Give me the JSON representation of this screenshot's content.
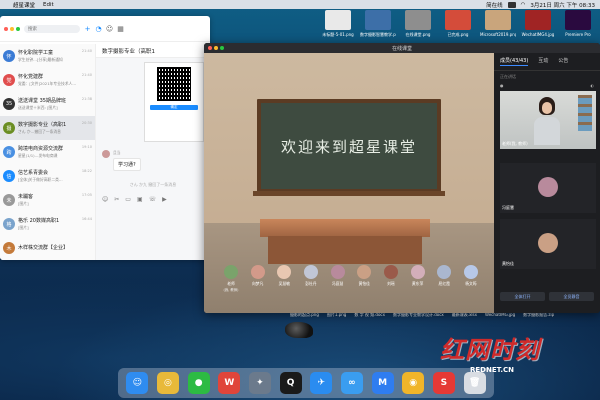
{
  "menubar": {
    "app_name": "超星课堂",
    "edit": "Edit",
    "clock": "3月21日 周六 下午 08:33",
    "tray_label": "简在线"
  },
  "desktop": {
    "files_top": [
      {
        "name": "未标题-5-01.png",
        "color": "#e9e9e9"
      },
      {
        "name": "数字摄影智慧教学.png",
        "color": "#3d6fa8"
      },
      {
        "name": "在线课堂.png",
        "color": "#8e8e8e"
      },
      {
        "name": "已完成.png",
        "color": "#d44c3a"
      },
      {
        "name": "Microsoft2019.png",
        "color": "#c9a57c"
      },
      {
        "name": "WechatIMG4.jpg",
        "color": "#a02424"
      },
      {
        "name": "Premiere Pro",
        "color": "#2a0a3f"
      }
    ],
    "files_bottom": [
      "摄影的起点.png",
      "图片1.png",
      "数 字 视 频.docx",
      "数字摄影专业教学设计.docx",
      "最新课表.xlsx",
      "WechatIMG.jpg",
      "数字摄影报告.zip"
    ]
  },
  "chat": {
    "search_placeholder": "搜索",
    "title": "数字摄影专业（高职1",
    "conversations": [
      {
        "name": "怀化职院学工童",
        "msg": "学生处钟…[分享]最新通知",
        "time": "21:40",
        "color": "#3a7bd5",
        "avatar_text": "怀"
      },
      {
        "name": "怀化党建群",
        "msg": "党委：[文件]2021年专业技术人…",
        "time": "21:40",
        "color": "#e04d4d",
        "avatar_text": "党"
      },
      {
        "name": "送送课堂 35期品牌班",
        "msg": "送送课堂＋米西: [图片]",
        "time": "21:38",
        "color": "#333333",
        "avatar_text": "35"
      },
      {
        "name": "数字摄影专业（高职1",
        "msg": "さん か…撤回了一条消息",
        "time": "20:30",
        "color": "#6b8e23",
        "avatar_text": "摄"
      },
      {
        "name": "跨境电商资源交流群",
        "msg": "星星(1/1)…发布电商课",
        "time": "19:10",
        "color": "#4a90e2",
        "avatar_text": "跨"
      },
      {
        "name": "信艺系青委会",
        "msg": "[全体]关于做好高职二类…",
        "time": "18:22",
        "color": "#1a8cff",
        "avatar_text": "信"
      },
      {
        "name": "未蹦客",
        "msg": "[图片]",
        "time": "17:05",
        "color": "#999999",
        "avatar_text": "未"
      },
      {
        "name": "格乐 20数媒高职1",
        "msg": "[图片]",
        "time": "16:44",
        "color": "#7aa3cc",
        "avatar_text": "格"
      },
      {
        "name": "木样株交流群【企业】",
        "msg": "",
        "time": "",
        "color": "#c47a3a",
        "avatar_text": "木"
      }
    ],
    "qr_button": "确定",
    "message": {
      "sender": "且当",
      "text": "学习通?"
    },
    "recall_notice": "さん か九  撤回了一条消息"
  },
  "classroom": {
    "window_title": "在线课堂",
    "board_text": "欢迎来到超星课堂",
    "participants": [
      {
        "name": "老师",
        "sub": "(我, 教师)",
        "color": "#7aa36b"
      },
      {
        "name": "向梦凡",
        "sub": "",
        "color": "#d39a8a"
      },
      {
        "name": "吴慧敏",
        "sub": "",
        "color": "#e8c7b1"
      },
      {
        "name": "彭杜丹",
        "sub": "",
        "color": "#c1c6d6"
      },
      {
        "name": "冯庭慧",
        "sub": "",
        "color": "#b88a9c"
      },
      {
        "name": "黄怡佳",
        "sub": "",
        "color": "#caa085"
      },
      {
        "name": "刘瑶",
        "sub": "",
        "color": "#9a5a4a"
      },
      {
        "name": "黄东萍",
        "sub": "",
        "color": "#d3aeb9"
      },
      {
        "name": "屈红霞",
        "sub": "",
        "color": "#aab7cf"
      },
      {
        "name": "杨文筠",
        "sub": "",
        "color": "#b7c8e8"
      }
    ],
    "side": {
      "tab_members": "成员(43/43)",
      "tab_interact": "互动",
      "tab_announce": "公告",
      "speaking_label": "正在讲话",
      "teacher_label": "老师(我, 教师)",
      "student1_label": "冯庭慧",
      "student2_label": "黄怡佳",
      "button_left": "全体打开",
      "button_right": "全员静音"
    }
  },
  "dock": {
    "apps": [
      {
        "name": "finder",
        "glyph": "☺",
        "color": "#2f8cf0"
      },
      {
        "name": "chrome",
        "glyph": "◎",
        "color": "#e8b93a"
      },
      {
        "name": "wechat",
        "glyph": "●",
        "color": "#2dbb43"
      },
      {
        "name": "wps",
        "glyph": "W",
        "color": "#e0453a"
      },
      {
        "name": "launchpad",
        "glyph": "✦",
        "color": "#6b7a8c"
      },
      {
        "name": "qq",
        "glyph": "Q",
        "color": "#1a1a1a"
      },
      {
        "name": "dingtalk",
        "glyph": "✈",
        "color": "#2a8cf0"
      },
      {
        "name": "baidu-netdisk",
        "glyph": "∞",
        "color": "#3a9df0"
      },
      {
        "name": "tencent-meeting",
        "glyph": "M",
        "color": "#2f7df0"
      },
      {
        "name": "xiaoying",
        "glyph": "◉",
        "color": "#f0b52a"
      },
      {
        "name": "xuexitong",
        "glyph": "S",
        "color": "#e53935"
      },
      {
        "name": "trash",
        "glyph": "🗑",
        "color": "#d9dde3"
      }
    ]
  },
  "watermark": {
    "text": "红网时刻",
    "sub": "REDNET.CN"
  }
}
